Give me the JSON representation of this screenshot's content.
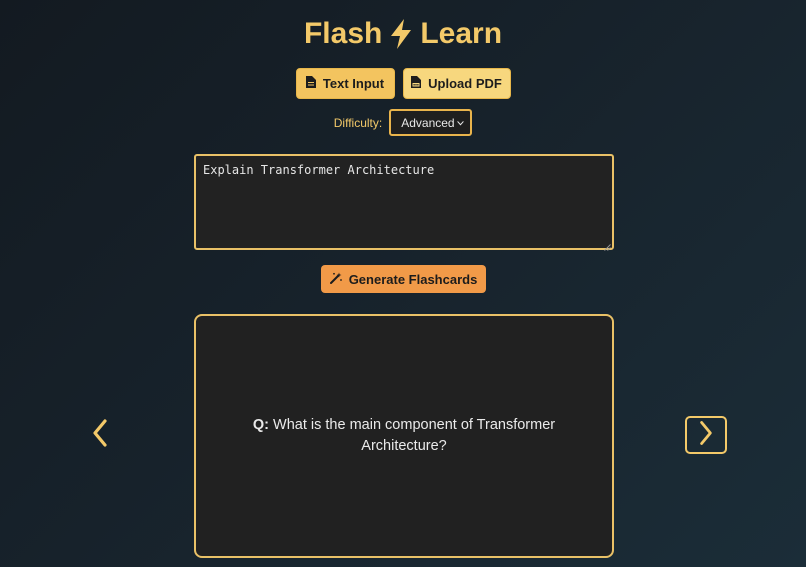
{
  "app": {
    "title_left": "Flash",
    "title_right": "Learn",
    "title_icon": "lightning-bolt-icon"
  },
  "modes": {
    "text_input_label": "Text Input",
    "text_input_icon": "file-icon",
    "upload_pdf_label": "Upload PDF",
    "upload_pdf_icon": "pdf-file-icon",
    "active": "Text Input"
  },
  "difficulty": {
    "label": "Difficulty:",
    "selected": "Advanced"
  },
  "input": {
    "value": "Explain Transformer Architecture"
  },
  "generate": {
    "label": "Generate Flashcards",
    "icon": "magic-wand-icon"
  },
  "flashcard": {
    "prefix": "Q:",
    "question": "What is the main component of Transformer Architecture?"
  },
  "navigation": {
    "prev_icon": "chevron-left-icon",
    "next_icon": "chevron-right-icon"
  },
  "colors": {
    "accent": "#f3c969",
    "generate": "#f19a48",
    "card_bg": "#212121"
  }
}
